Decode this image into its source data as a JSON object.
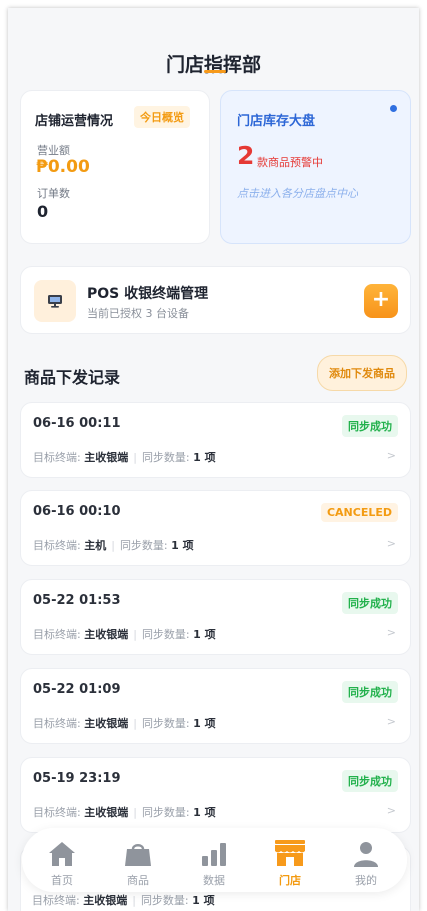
{
  "header": {
    "title": "门店指挥部"
  },
  "ops": {
    "title": "店铺运营情况",
    "badge": "今日概览",
    "revenue_label": "营业额",
    "revenue_value": "₱0.00",
    "orders_label": "订单数",
    "orders_value": "0"
  },
  "stock": {
    "title": "门店库存大盘",
    "alert_count": "2",
    "alert_text": "款商品预警中",
    "hint": "点击进入各分店盘点中心"
  },
  "pos": {
    "title": "POS 收银终端管理",
    "subtitle": "当前已授权 3 台设备",
    "add_label": "+"
  },
  "records": {
    "section_title": "商品下发记录",
    "add_button": "添加下发商品",
    "target_label": "目标终端:",
    "qty_label": "同步数量:",
    "arrow": ">",
    "items": [
      {
        "time": "06-16 00:11",
        "status": "同步成功",
        "target": "主收银端",
        "qty": "1 项"
      },
      {
        "time": "06-16 00:10",
        "status": "CANCELED",
        "target": "主机",
        "qty": "1 项"
      },
      {
        "time": "05-22 01:53",
        "status": "同步成功",
        "target": "主收银端",
        "qty": "1 项"
      },
      {
        "time": "05-22 01:09",
        "status": "同步成功",
        "target": "主收银端",
        "qty": "1 项"
      },
      {
        "time": "05-19 23:19",
        "status": "同步成功",
        "target": "主收银端",
        "qty": "1 项"
      },
      {
        "target": "主收银端",
        "qty": "1 项"
      }
    ]
  },
  "tabbar": {
    "items": [
      {
        "label": "首页",
        "icon": "home-icon"
      },
      {
        "label": "商品",
        "icon": "shopping-bag-icon"
      },
      {
        "label": "数据",
        "icon": "bar-chart-icon"
      },
      {
        "label": "门店",
        "icon": "store-icon"
      },
      {
        "label": "我的",
        "icon": "user-icon"
      }
    ],
    "active": "门店"
  },
  "colors": {
    "accent": "#f39b12",
    "primary_blue": "#2c66d6",
    "alert_red": "#e53935",
    "success_green": "#22b14c"
  }
}
